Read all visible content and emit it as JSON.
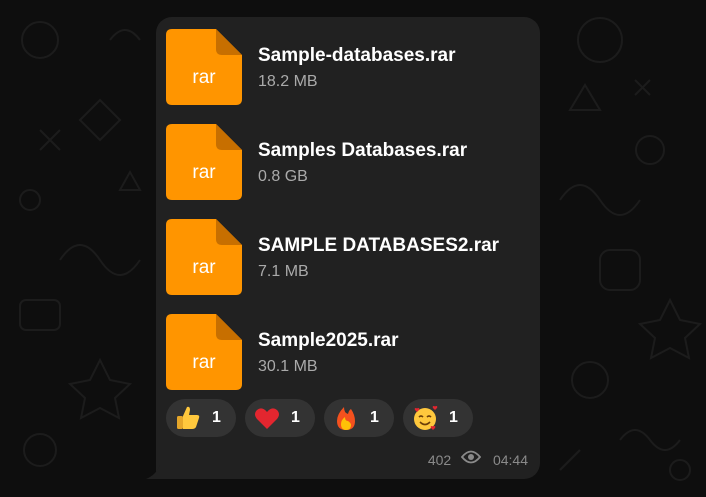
{
  "colors": {
    "background": "#0e0e0e",
    "bubble": "#212121",
    "file_icon": "#ff9500",
    "file_fold": "#c76f00",
    "reaction_bg": "#333333",
    "meta_text": "#8a8a8a"
  },
  "files": [
    {
      "ext": "rar",
      "name": "Sample-databases.rar",
      "size": "18.2 MB",
      "icon": "file-icon"
    },
    {
      "ext": "rar",
      "name": "Samples Databases.rar",
      "size": "0.8 GB",
      "icon": "file-icon"
    },
    {
      "ext": "rar",
      "name": "SAMPLE DATABASES2.rar",
      "size": "7.1 MB",
      "icon": "file-icon"
    },
    {
      "ext": "rar",
      "name": "Sample2025.rar",
      "size": "30.1 MB",
      "icon": "file-icon"
    }
  ],
  "reactions": [
    {
      "emoji": "thumbs-up",
      "count": "1"
    },
    {
      "emoji": "red-heart",
      "count": "1"
    },
    {
      "emoji": "fire",
      "count": "1"
    },
    {
      "emoji": "smiling-face-with-hearts",
      "count": "1"
    }
  ],
  "meta": {
    "views": "402",
    "views_icon": "eye-icon",
    "time": "04:44"
  }
}
